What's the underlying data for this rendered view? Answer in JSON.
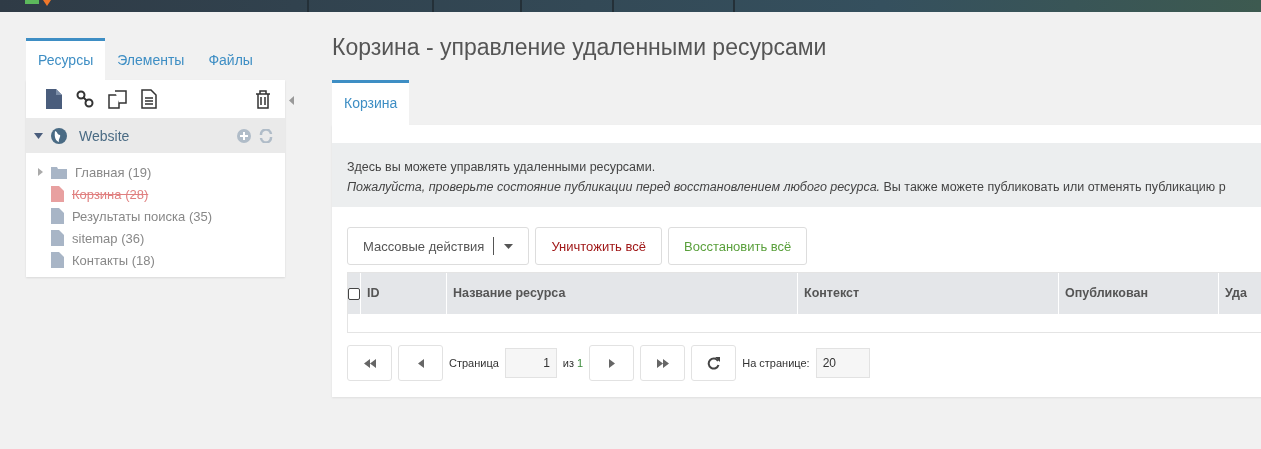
{
  "sidebar": {
    "tabs": [
      {
        "label": "Ресурсы",
        "selected": true
      },
      {
        "label": "Элементы",
        "selected": false
      },
      {
        "label": "Файлы",
        "selected": false
      }
    ],
    "tree": [
      {
        "label": "Website",
        "kind": "context",
        "expanded": true,
        "children": [
          {
            "label": "Главная (19)",
            "kind": "folder",
            "expanded": false,
            "deleted": false
          },
          {
            "label": "Корзина (28)",
            "kind": "document",
            "deleted": true
          },
          {
            "label": "Результаты поиска (35)",
            "kind": "document",
            "deleted": false
          },
          {
            "label": "sitemap (36)",
            "kind": "document",
            "deleted": false
          },
          {
            "label": "Контакты (18)",
            "kind": "document",
            "deleted": false
          }
        ]
      }
    ]
  },
  "page": {
    "title": "Корзина - управление удаленными ресурсами",
    "tabs": [
      {
        "label": "Корзина",
        "selected": true
      }
    ],
    "intro": "Здесь вы можете управлять удаленными ресурсами.",
    "note": "*Пожалуйста, проверьте состояние публикации перед восстановлением любого ресурса.* Вы также можете публиковать или отменять публикацию р",
    "bulk_actions": "Массовые действия",
    "buttons": [
      {
        "label": "Уничтожить всё",
        "kind": "danger"
      },
      {
        "label": "Восстановить всё",
        "kind": "success"
      }
    ],
    "table": {
      "select_all": {
        "checked": false
      },
      "columns": [
        "ID",
        "Название ресурса",
        "Контекст",
        "Опубликован",
        "Уда"
      ]
    },
    "pager": {
      "page_label": "Страница",
      "page": "1",
      "of_label": "из",
      "total": "1",
      "per_page_label": "На странице:",
      "per_page": "20"
    }
  }
}
